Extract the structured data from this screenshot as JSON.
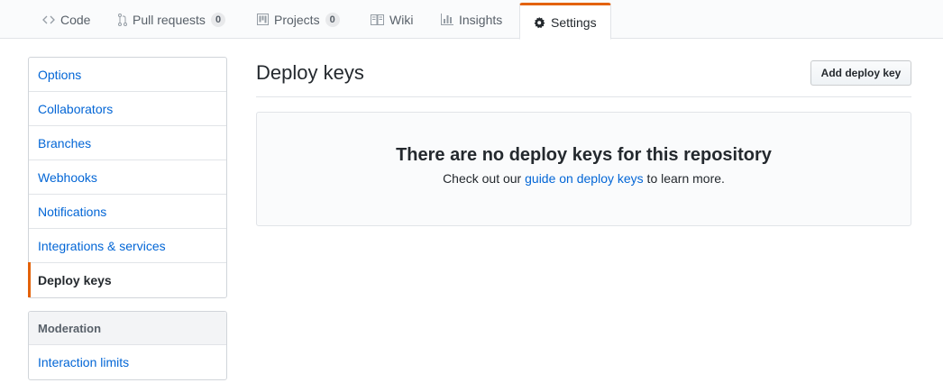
{
  "nav": {
    "tabs": [
      {
        "label": "Code",
        "icon": "code-icon"
      },
      {
        "label": "Pull requests",
        "icon": "git-pull-request-icon",
        "count": "0"
      },
      {
        "label": "Projects",
        "icon": "project-icon",
        "count": "0"
      },
      {
        "label": "Wiki",
        "icon": "book-icon"
      },
      {
        "label": "Insights",
        "icon": "graph-icon"
      },
      {
        "label": "Settings",
        "icon": "gear-icon",
        "selected": true
      }
    ]
  },
  "sidebar": {
    "items": [
      {
        "label": "Options"
      },
      {
        "label": "Collaborators"
      },
      {
        "label": "Branches"
      },
      {
        "label": "Webhooks"
      },
      {
        "label": "Notifications"
      },
      {
        "label": "Integrations & services"
      },
      {
        "label": "Deploy keys",
        "selected": true
      }
    ],
    "moderation": {
      "heading": "Moderation",
      "items": [
        {
          "label": "Interaction limits"
        }
      ]
    }
  },
  "main": {
    "title": "Deploy keys",
    "add_button": "Add deploy key",
    "blankslate": {
      "heading": "There are no deploy keys for this repository",
      "text_before": "Check out our ",
      "link": "guide on deploy keys",
      "text_after": " to learn more."
    }
  },
  "colors": {
    "accent": "#e36209",
    "link": "#0366d6",
    "text": "#24292e",
    "muted": "#586069"
  }
}
